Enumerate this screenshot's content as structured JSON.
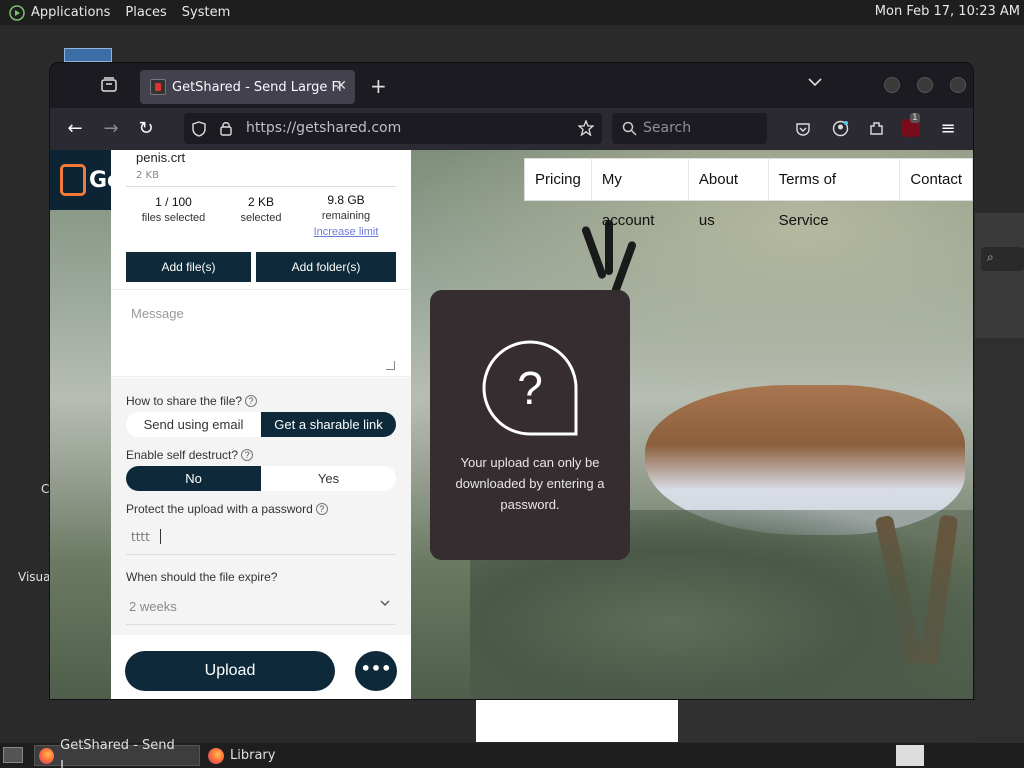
{
  "topbar": {
    "menus": [
      "Applications",
      "Places",
      "System"
    ],
    "clock": "Mon Feb 17, 10:23 AM"
  },
  "desktop": {
    "labels": [
      "C",
      "Visua"
    ]
  },
  "browser": {
    "tab_title": "GetShared - Send Large Files",
    "url": "https://getshared.com",
    "search_placeholder": "Search",
    "ublock_badge": "1"
  },
  "site": {
    "logo_text": "Ge",
    "nav": [
      "Pricing",
      "My account",
      "About us",
      "Terms of Service",
      "Contact"
    ]
  },
  "panel": {
    "file_name": "penis.crt",
    "file_size": "2 KB",
    "stats": [
      {
        "value": "1 / 100",
        "label": "files selected"
      },
      {
        "value": "2 KB",
        "label": "selected"
      },
      {
        "value": "9.8 GB",
        "label": "remaining",
        "link": "Increase limit"
      }
    ],
    "add_files": "Add file(s)",
    "add_folder": "Add folder(s)",
    "message_placeholder": "Message",
    "share_label": "How to share the file?",
    "share_options": [
      "Send using email",
      "Get a sharable link"
    ],
    "share_selected": "Get a sharable link",
    "destruct_label": "Enable self destruct?",
    "destruct_options": [
      "No",
      "Yes"
    ],
    "destruct_selected": "No",
    "password_label": "Protect the upload with a password",
    "password_value": "tttt",
    "expire_label": "When should the file expire?",
    "expire_value": "2 weeks",
    "upload_label": "Upload",
    "more_label": "•••"
  },
  "info_card": {
    "text": "Your upload can only be downloaded by entering a password."
  },
  "taskbar": {
    "tasks": [
      "GetShared - Send L...",
      "Library"
    ]
  },
  "colors": {
    "brand_dark": "#0e2a3a",
    "card_bg": "#352d2f",
    "logo_accent": "#f47a3a"
  }
}
